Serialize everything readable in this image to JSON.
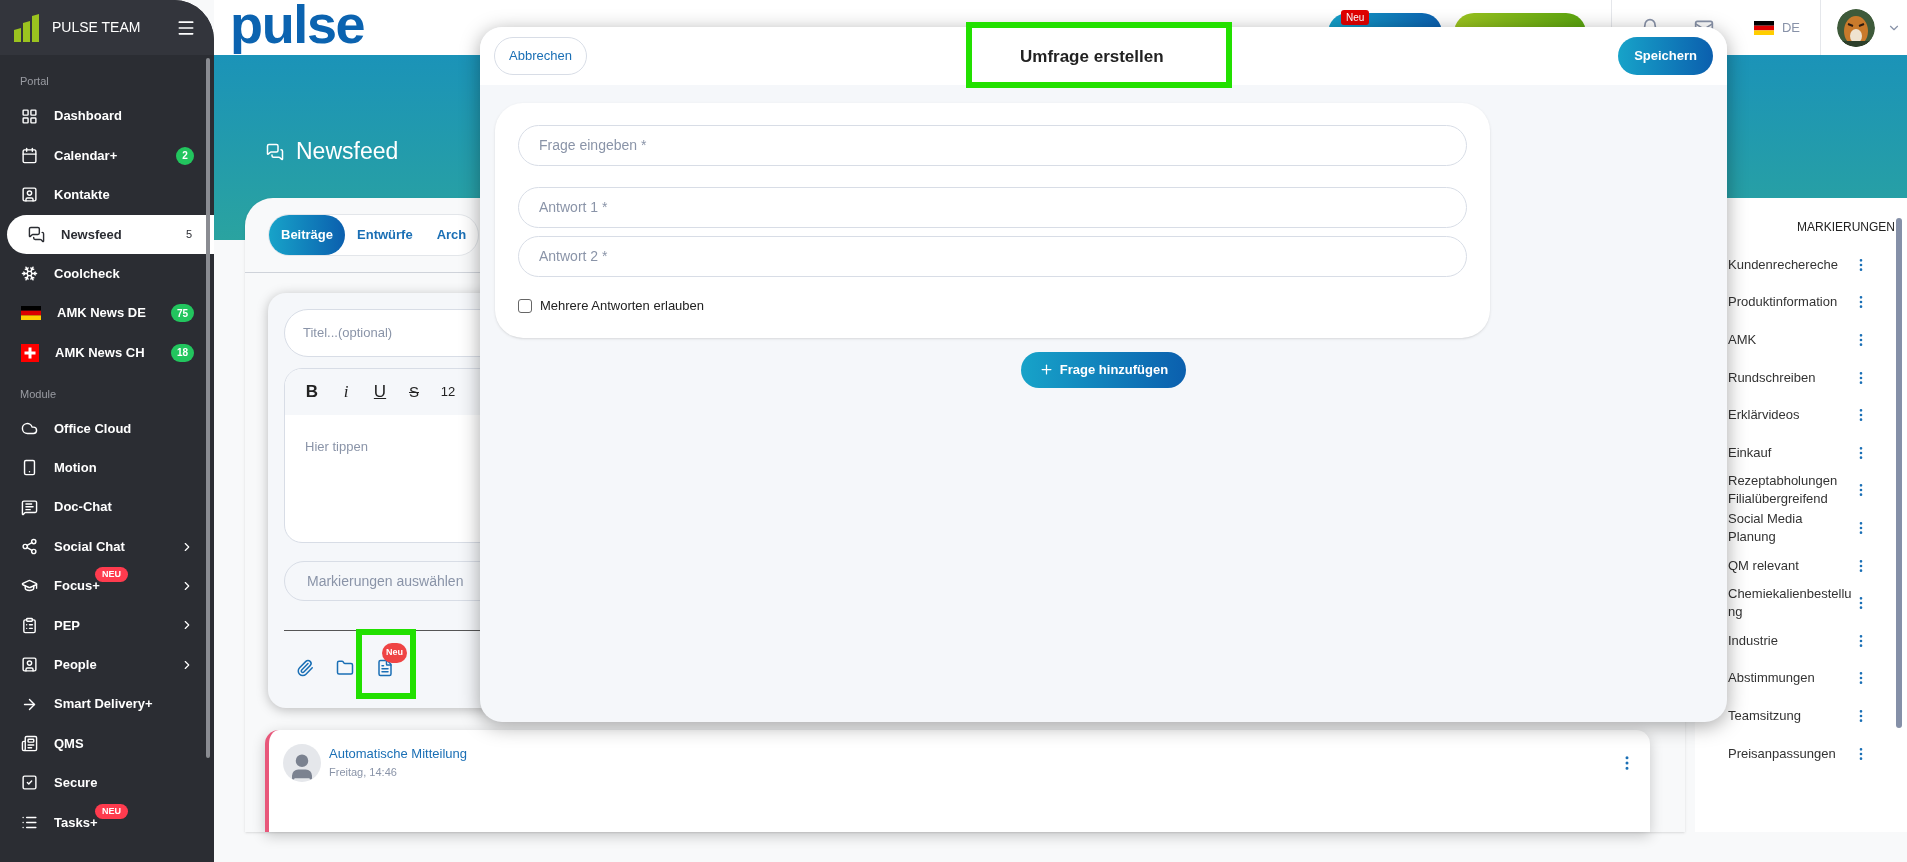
{
  "sidebar": {
    "brand": "PULSE TEAM",
    "sections": [
      {
        "label": "Portal",
        "items": [
          {
            "label": "Dashboard",
            "selected": false,
            "has_submenu": false
          },
          {
            "label": "Calendar+",
            "count": "2",
            "selected": false,
            "has_submenu": false
          },
          {
            "label": "Kontakte",
            "selected": false,
            "has_submenu": false
          },
          {
            "label": "Newsfeed",
            "count": "5",
            "selected": true,
            "has_submenu": false
          },
          {
            "label": "Coolcheck",
            "selected": false,
            "has_submenu": false
          },
          {
            "label": "AMK News DE",
            "count": "75",
            "selected": false,
            "has_submenu": false
          },
          {
            "label": "AMK News CH",
            "count": "18",
            "selected": false,
            "has_submenu": false
          }
        ]
      },
      {
        "label": "Module",
        "items": [
          {
            "label": "Office Cloud",
            "selected": false,
            "has_submenu": false
          },
          {
            "label": "Motion",
            "selected": false,
            "has_submenu": false
          },
          {
            "label": "Doc-Chat",
            "selected": false,
            "has_submenu": false
          },
          {
            "label": "Social Chat",
            "selected": false,
            "has_submenu": true
          },
          {
            "label": "Focus+",
            "new_badge": "NEU",
            "selected": false,
            "has_submenu": true
          },
          {
            "label": "PEP",
            "selected": false,
            "has_submenu": true
          },
          {
            "label": "People",
            "selected": false,
            "has_submenu": true
          },
          {
            "label": "Smart Delivery+",
            "selected": false,
            "has_submenu": false
          },
          {
            "label": "QMS",
            "selected": false,
            "has_submenu": false
          },
          {
            "label": "Secure",
            "selected": false,
            "has_submenu": false
          },
          {
            "label": "Tasks+",
            "new_badge": "NEU",
            "selected": false,
            "has_submenu": false
          }
        ]
      }
    ]
  },
  "header": {
    "logo": "pulse",
    "smartguide": {
      "badge": "Neu"
    },
    "language": "DE"
  },
  "page_title": "Newsfeed",
  "tabs": [
    {
      "label": "Beiträge",
      "selected": true
    },
    {
      "label": "Entwürfe",
      "selected": false
    },
    {
      "label": "Arch",
      "selected": false
    }
  ],
  "composer": {
    "title_placeholder": "Titel...(optional)",
    "toolbar": [
      {
        "label": "B",
        "kind": "bold"
      },
      {
        "label": "i",
        "kind": "italic"
      },
      {
        "label": "U",
        "kind": "underline"
      },
      {
        "label": "S",
        "kind": "strike"
      },
      {
        "label": "12",
        "kind": "size"
      }
    ],
    "body_placeholder": "Hier tippen",
    "tags_placeholder": "Markierungen auswählen",
    "poll_badge": "Neu"
  },
  "post": {
    "author": "Automatische Mitteilung",
    "time": "Freitag, 14:46"
  },
  "tags_panel": {
    "title": "MARKIERUNGEN",
    "items": [
      "Kundenrechereche",
      "Produktinformation",
      "AMK",
      "Rundschreiben",
      "Erklärvideos",
      "Einkauf",
      "Rezeptabholungen Filialübergreifend",
      "Social Media Planung",
      "QM relevant",
      "Chemiekalienbestellung",
      "Industrie",
      "Abstimmungen",
      "Teamsitzung",
      "Preisanpassungen"
    ]
  },
  "modal": {
    "cancel": "Abbrechen",
    "title": "Umfrage erstellen",
    "save": "Speichern",
    "question_placeholder": "Frage eingeben *",
    "answers": [
      "Antwort 1 *",
      "Antwort 2 *"
    ],
    "multiple": {
      "label": "Mehrere Antworten erlauben",
      "checked": false
    },
    "add_question": "Frage hinzufügen"
  }
}
